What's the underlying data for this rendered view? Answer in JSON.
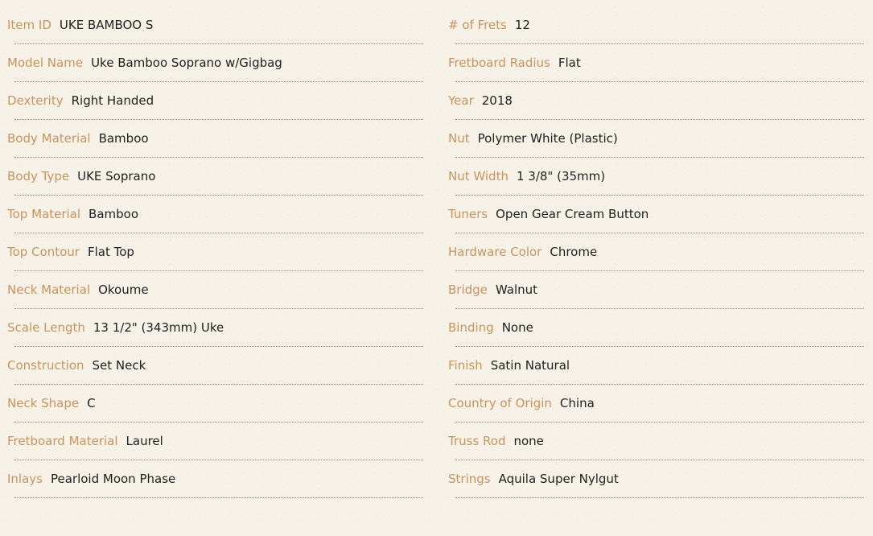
{
  "specs": {
    "left": [
      {
        "label": "Item ID",
        "value": "UKE BAMBOO S"
      },
      {
        "label": "Model Name",
        "value": "Uke Bamboo Soprano w/Gigbag"
      },
      {
        "label": "Dexterity",
        "value": "Right Handed"
      },
      {
        "label": "Body Material",
        "value": "Bamboo"
      },
      {
        "label": "Body Type",
        "value": "UKE Soprano"
      },
      {
        "label": "Top Material",
        "value": "Bamboo"
      },
      {
        "label": "Top Contour",
        "value": "Flat Top"
      },
      {
        "label": "Neck Material",
        "value": "Okoume"
      },
      {
        "label": "Scale Length",
        "value": "13 1/2\" (343mm) Uke"
      },
      {
        "label": "Construction",
        "value": "Set Neck"
      },
      {
        "label": "Neck Shape",
        "value": "C"
      },
      {
        "label": "Fretboard Material",
        "value": "Laurel"
      },
      {
        "label": "Inlays",
        "value": "Pearloid Moon Phase"
      }
    ],
    "right": [
      {
        "label": "# of Frets",
        "value": "12"
      },
      {
        "label": "Fretboard Radius",
        "value": "Flat"
      },
      {
        "label": "Year",
        "value": "2018"
      },
      {
        "label": "Nut",
        "value": "Polymer White (Plastic)"
      },
      {
        "label": "Nut Width",
        "value": "1 3/8\" (35mm)"
      },
      {
        "label": "Tuners",
        "value": "Open Gear Cream Button"
      },
      {
        "label": "Hardware Color",
        "value": "Chrome"
      },
      {
        "label": "Bridge",
        "value": "Walnut"
      },
      {
        "label": "Binding",
        "value": "None"
      },
      {
        "label": "Finish",
        "value": "Satin Natural"
      },
      {
        "label": "Country of Origin",
        "value": "China"
      },
      {
        "label": "Truss Rod",
        "value": "none"
      },
      {
        "label": "Strings",
        "value": "Aquila Super Nylgut"
      }
    ]
  },
  "colors": {
    "background": "#f6f2e8",
    "label": "#c9935b",
    "value": "#1f1f1f",
    "rule": "#8c8579"
  }
}
